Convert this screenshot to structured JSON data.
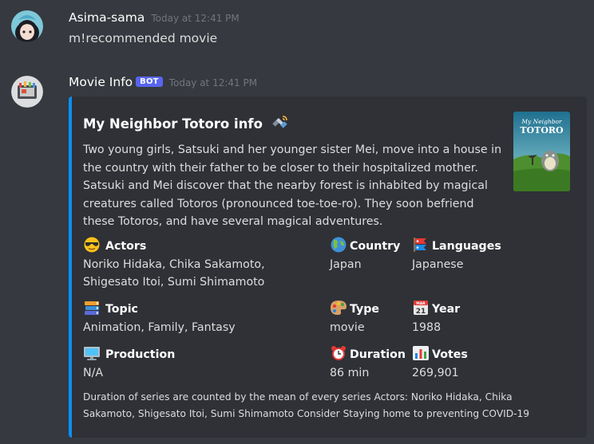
{
  "messages": [
    {
      "username": "Asima-sama",
      "timestamp": "Today at 12:41 PM",
      "text": "m!recommended movie"
    },
    {
      "username": "Movie Info",
      "badge": "BOT",
      "timestamp": "Today at 12:41 PM"
    }
  ],
  "embed": {
    "title": "My Neighbor Totoro info",
    "title_icon": "satellite-icon",
    "accent_color": "#0b8ef5",
    "thumbnail_text": [
      "My Neighbor",
      "TOTORO"
    ],
    "description": "Two young girls, Satsuki and her younger sister Mei, move into a house in the country with their father to be closer to their hospitalized mother. Satsuki and Mei discover that the nearby forest is inhabited by magical creatures called Totoros (pronounced toe-toe-ro). They soon befriend these Totoros, and have several magical adventures.",
    "fields": [
      {
        "icon": "sunglasses-face-icon",
        "name": "Actors",
        "value_lines": [
          "Noriko Hidaka, Chika Sakamoto,",
          "Shigesato Itoi, Sumi Shimamoto"
        ]
      },
      {
        "icon": "globe-icon",
        "name": "Country",
        "value_lines": [
          "Japan"
        ]
      },
      {
        "icon": "carp-streamer-icon",
        "name": "Languages",
        "value_lines": [
          "Japanese"
        ]
      },
      {
        "icon": "books-icon",
        "name": "Topic",
        "value_lines": [
          "Animation, Family, Fantasy"
        ]
      },
      {
        "icon": "palette-icon",
        "name": "Type",
        "value_lines": [
          "movie"
        ]
      },
      {
        "icon": "calendar-icon",
        "name": "Year",
        "value_lines": [
          "1988"
        ]
      },
      {
        "icon": "computer-icon",
        "name": "Production",
        "value_lines": [
          "N/A"
        ]
      },
      {
        "icon": "alarm-clock-icon",
        "name": "Duration",
        "value_lines": [
          "86 min"
        ]
      },
      {
        "icon": "bar-chart-icon",
        "name": "Votes",
        "value_lines": [
          "269,901"
        ]
      }
    ],
    "calendar_icon_text": {
      "month": "MAR",
      "day": "21"
    },
    "footer": "Duration of series are counted by the mean of every series Actors: Noriko Hidaka, Chika Sakamoto, Shigesato Itoi, Sumi Shimamoto  Consider Staying home to preventing COVID-19"
  }
}
